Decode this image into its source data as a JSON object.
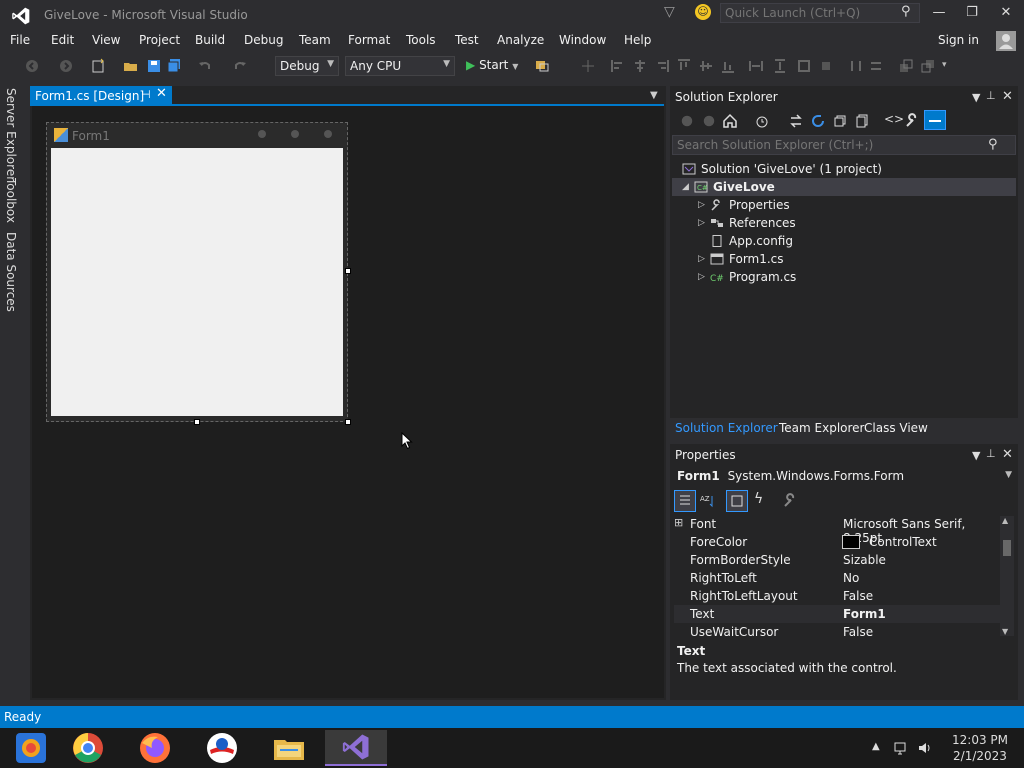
{
  "window": {
    "title": "GiveLove - Microsoft Visual Studio",
    "quick_launch_placeholder": "Quick Launch (Ctrl+Q)",
    "minimize": "—",
    "restore": "❐",
    "close": "✕"
  },
  "menu": {
    "items": [
      "File",
      "Edit",
      "View",
      "Project",
      "Build",
      "Debug",
      "Team",
      "Format",
      "Tools",
      "Test",
      "Analyze",
      "Window",
      "Help"
    ],
    "sign_in": "Sign in"
  },
  "toolbar": {
    "configuration": "Debug",
    "platform": "Any CPU",
    "start_label": "Start"
  },
  "left_rail": {
    "tabs": [
      "Server Explorer",
      "Toolbox",
      "Data Sources"
    ]
  },
  "document": {
    "tab_label": "Form1.cs [Design]",
    "form_title": "Form1"
  },
  "solution_explorer": {
    "title": "Solution Explorer",
    "search_placeholder": "Search Solution Explorer (Ctrl+;)",
    "solution_label": "Solution 'GiveLove' (1 project)",
    "project": "GiveLove",
    "items": [
      "Properties",
      "References",
      "App.config",
      "Form1.cs",
      "Program.cs"
    ],
    "bottom_tabs": [
      "Solution Explorer",
      "Team Explorer",
      "Class View"
    ]
  },
  "properties": {
    "title": "Properties",
    "object_name": "Form1",
    "object_type": "System.Windows.Forms.Form",
    "rows": [
      {
        "name": "Font",
        "value": "Microsoft Sans Serif, 8.25pt"
      },
      {
        "name": "ForeColor",
        "value": "ControlText"
      },
      {
        "name": "FormBorderStyle",
        "value": "Sizable"
      },
      {
        "name": "RightToLeft",
        "value": "No"
      },
      {
        "name": "RightToLeftLayout",
        "value": "False"
      },
      {
        "name": "Text",
        "value": "Form1"
      },
      {
        "name": "UseWaitCursor",
        "value": "False"
      }
    ],
    "desc_title": "Text",
    "desc_text": "The text associated with the control."
  },
  "status": {
    "text": "Ready"
  },
  "taskbar": {
    "apps": [
      "app-blue-icon",
      "chrome-icon",
      "firefox-icon",
      "obama-icon",
      "file-explorer-icon",
      "visual-studio-icon"
    ],
    "time": "12:03 PM",
    "date": "2/1/2023"
  },
  "colors": {
    "accent": "#007acc",
    "background": "#2d2d30",
    "panel": "#252526"
  }
}
